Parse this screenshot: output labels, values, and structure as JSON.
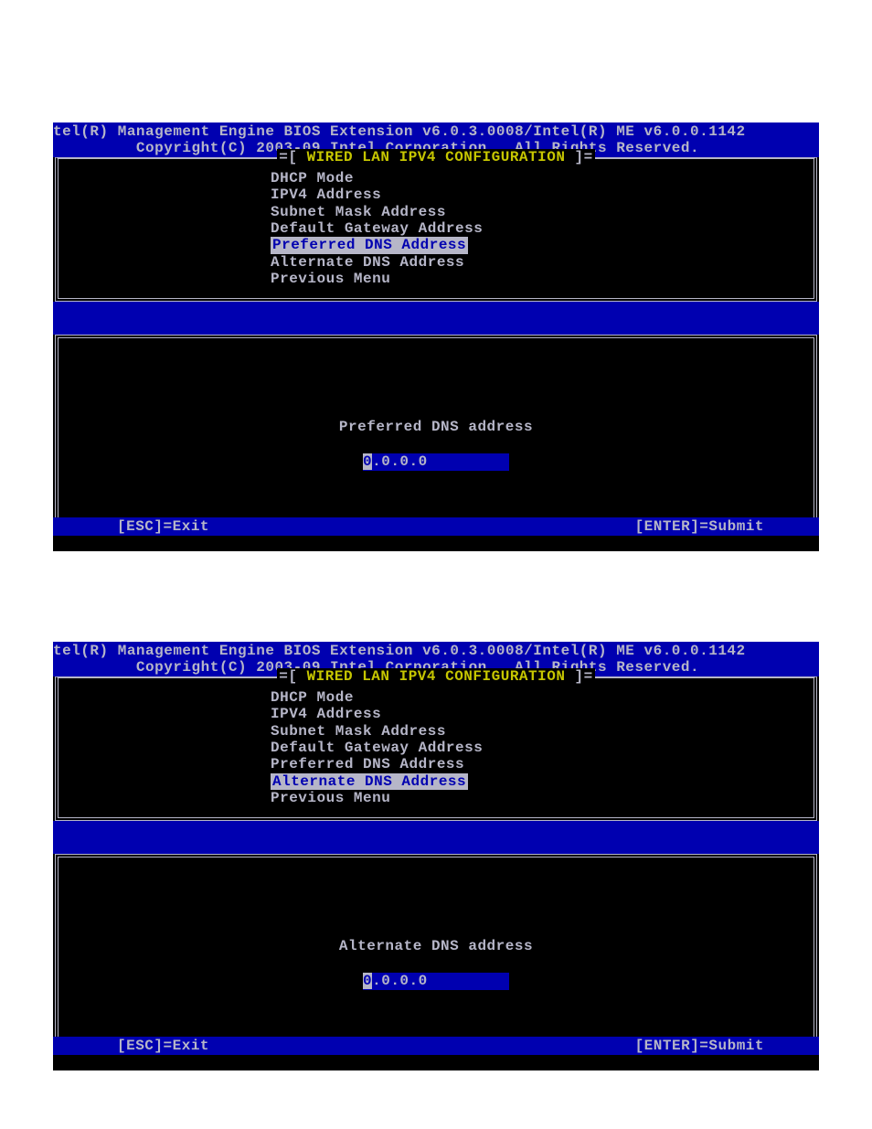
{
  "header": {
    "line1": "tel(R) Management Engine BIOS Extension v6.0.3.0008/Intel(R) ME v6.0.0.1142",
    "line2": "         Copyright(C) 2003-09 Intel Corporation.  All Rights Reserved."
  },
  "panel_title": {
    "prefix": "[ ",
    "text": "WIRED LAN IPV4 CONFIGURATION",
    "suffix": " ]"
  },
  "menu_items": [
    "DHCP Mode",
    "IPV4 Address",
    "Subnet Mask Address",
    "Default Gateway Address",
    "Preferred DNS Address",
    "Alternate DNS Address",
    "Previous Menu"
  ],
  "screen1": {
    "selected_index": 4,
    "prompt_label": "Preferred DNS address",
    "input_value": "0.0.0.0"
  },
  "screen2": {
    "selected_index": 5,
    "prompt_label": "Alternate DNS address",
    "input_value": "0.0.0.0"
  },
  "footer": {
    "left": "[ESC]=Exit",
    "right": "[ENTER]=Submit"
  }
}
